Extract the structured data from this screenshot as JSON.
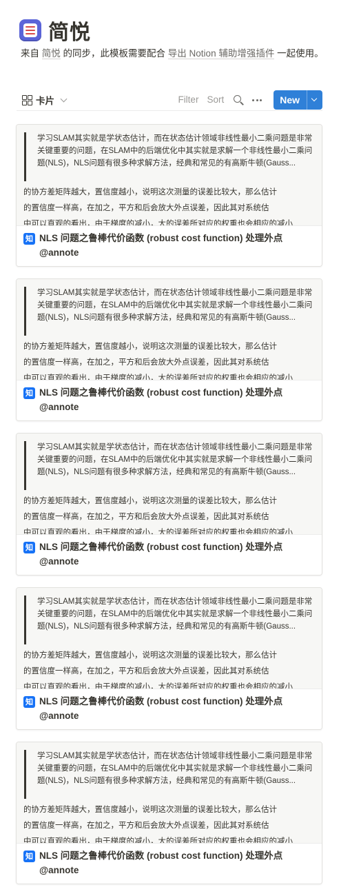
{
  "header": {
    "title": "简悦",
    "desc_prefix": "来自",
    "desc_link1": "简悦",
    "desc_middle": "的同步，此模板需要配合",
    "desc_link2": "导出 Notion 辅助增强插件",
    "desc_suffix": "一起使用。"
  },
  "toolbar": {
    "view_label": "卡片",
    "filter_label": "Filter",
    "sort_label": "Sort",
    "new_label": "New"
  },
  "icons": {
    "app": "simpread-app-icon",
    "view": "gallery-icon",
    "source": "zhihu-icon",
    "zhihu_glyph": "知"
  },
  "colors": {
    "accent": "#2f80d8",
    "zhihu": "#1772f6",
    "text": "#37352f",
    "muted": "#9b9a97"
  },
  "cards": [
    {
      "quote": "学习SLAM其实就是学状态估计，而在状态估计领域非线性最小二乘问题是非常关键重要的问题，在SLAM中的后端优化中其实就是求解一个非线性最小二乘问题(NLS)，NLS问题有很多种求解方法，经典和常见的有高斯牛顿(Gauss...",
      "para1": "的协方差矩阵越大，置信度越小，说明这次测量的误差比较大，那么估计",
      "para2": "的置信度一样高，在加之，平方和后会放大外点误差，因此其对系统估",
      "para3": "中可以直观的看出，由于梯度的减小，大的误差所对应的权重也会相应的减小",
      "title": "NLS 问题之鲁棒代价函数 (robust cost function) 处理外点",
      "author": "@annote"
    },
    {
      "quote": "学习SLAM其实就是学状态估计，而在状态估计领域非线性最小二乘问题是非常关键重要的问题，在SLAM中的后端优化中其实就是求解一个非线性最小二乘问题(NLS)，NLS问题有很多种求解方法，经典和常见的有高斯牛顿(Gauss...",
      "para1": "的协方差矩阵越大，置信度越小，说明这次测量的误差比较大，那么估计",
      "para2": "的置信度一样高，在加之，平方和后会放大外点误差，因此其对系统估",
      "para3": "中可以直观的看出，由于梯度的减小，大的误差所对应的权重也会相应的减小",
      "title": "NLS 问题之鲁棒代价函数 (robust cost function) 处理外点",
      "author": "@annote"
    },
    {
      "quote": "学习SLAM其实就是学状态估计，而在状态估计领域非线性最小二乘问题是非常关键重要的问题，在SLAM中的后端优化中其实就是求解一个非线性最小二乘问题(NLS)，NLS问题有很多种求解方法，经典和常见的有高斯牛顿(Gauss...",
      "para1": "的协方差矩阵越大，置信度越小，说明这次测量的误差比较大，那么估计",
      "para2": "的置信度一样高，在加之，平方和后会放大外点误差，因此其对系统估",
      "para3": "中可以直观的看出，由于梯度的减小，大的误差所对应的权重也会相应的减小",
      "title": "NLS 问题之鲁棒代价函数 (robust cost function) 处理外点",
      "author": "@annote"
    },
    {
      "quote": "学习SLAM其实就是学状态估计，而在状态估计领域非线性最小二乘问题是非常关键重要的问题，在SLAM中的后端优化中其实就是求解一个非线性最小二乘问题(NLS)，NLS问题有很多种求解方法，经典和常见的有高斯牛顿(Gauss...",
      "para1": "的协方差矩阵越大，置信度越小，说明这次测量的误差比较大，那么估计",
      "para2": "的置信度一样高，在加之，平方和后会放大外点误差，因此其对系统估",
      "para3": "中可以直观的看出，由于梯度的减小，大的误差所对应的权重也会相应的减小",
      "title": "NLS 问题之鲁棒代价函数 (robust cost function) 处理外点",
      "author": "@annote"
    },
    {
      "quote": "学习SLAM其实就是学状态估计，而在状态估计领域非线性最小二乘问题是非常关键重要的问题，在SLAM中的后端优化中其实就是求解一个非线性最小二乘问题(NLS)，NLS问题有很多种求解方法，经典和常见的有高斯牛顿(Gauss...",
      "para1": "的协方差矩阵越大，置信度越小，说明这次测量的误差比较大，那么估计",
      "para2": "的置信度一样高，在加之，平方和后会放大外点误差，因此其对系统估",
      "para3": "中可以直观的看出，由于梯度的减小，大的误差所对应的权重也会相应的减小",
      "title": "NLS 问题之鲁棒代价函数 (robust cost function) 处理外点",
      "author": "@annote"
    }
  ]
}
